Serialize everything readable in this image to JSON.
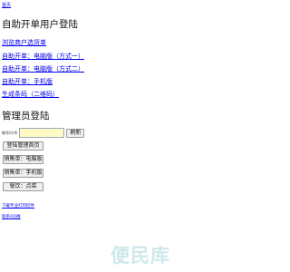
{
  "top_nav": {
    "home_link": "首页"
  },
  "self_checkout": {
    "title": "自助开单用户登陆",
    "links": [
      "浏览商户选货单",
      "自助开单：电脑版（方式一）",
      "自助开单：电脑版（方式二）",
      "自助开单：手机版",
      "生成条码（二维码）"
    ]
  },
  "admin": {
    "title": "管理员登陆",
    "account_label": "账号/口令",
    "account_value": "",
    "refresh_label": "刷新",
    "buttons": [
      "登陆管理首页",
      "销售单：电脑版",
      "销售单：手机版",
      "餐饮：点菜"
    ]
  },
  "footer_links": [
    "下载专业打印控件",
    "联系QQ群"
  ],
  "watermark": {
    "text": "便民库"
  }
}
